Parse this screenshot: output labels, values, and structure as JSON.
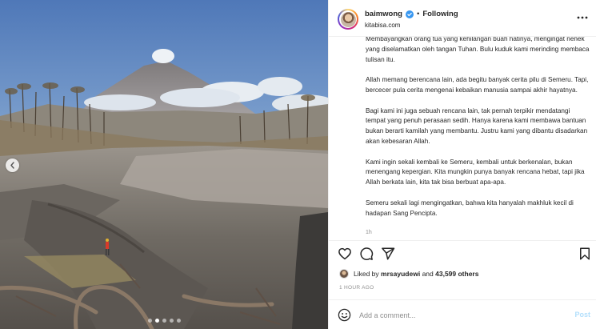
{
  "post": {
    "username": "baimwong",
    "separator": "•",
    "follow_state": "Following",
    "subline": "kitabisa.com",
    "caption_paragraphs": [
      "Membayangkan orang tua yang kehilangan buah hatinya, mengingat nenek yang diselamatkan oleh tangan Tuhan. Bulu kuduk kami merinding membaca tulisan itu.",
      "Allah memang berencana lain, ada begitu banyak cerita pilu di Semeru. Tapi, bercecer pula cerita mengenai kebaikan manusia sampai akhir hayatnya.",
      "Bagi kami ini juga sebuah rencana lain, tak pernah terpikir mendatangi tempat yang penuh perasaan sedih. Hanya karena kami membawa bantuan bukan berarti kamilah yang membantu. Justru kami yang dibantu disadarkan akan kebesaran Allah.",
      "Kami ingin sekali kembali ke Semeru, kembali untuk berkenalan, bukan menengang kepergian. Kita mungkin punya banyak rencana hebat, tapi jika Allah berkata lain, kita tak bisa berbuat apa-apa.",
      "Semeru sekali lagi mengingatkan, bahwa kita hanyalah makhluk kecil di hadapan Sang Pencipta."
    ],
    "caption_time": "1h",
    "likes": {
      "prefix": "Liked by",
      "liker": "mrsayudewi",
      "connector": "and",
      "count": "43,599 others"
    },
    "posted_time": "1 HOUR AGO",
    "comment": {
      "placeholder": "Add a comment...",
      "value": "",
      "post_label": "Post"
    },
    "carousel": {
      "slides": 5,
      "active_index": 1
    }
  },
  "icons": {
    "verified": "verified-badge-icon",
    "more": "more-options-icon",
    "like": "heart-icon",
    "comment": "comment-icon",
    "share": "paper-plane-icon",
    "save": "bookmark-icon",
    "emoji": "emoji-icon",
    "prev": "chevron-left-icon"
  },
  "colors": {
    "verified": "#3897f0",
    "post_button": "#b2dffc",
    "secondary_text": "#8e8e8e",
    "primary_text": "#262626"
  }
}
